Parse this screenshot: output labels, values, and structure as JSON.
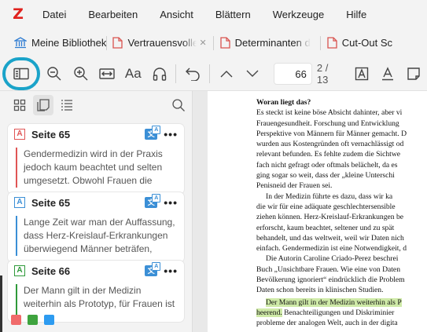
{
  "app": {
    "logo": "Z",
    "menu": [
      "Datei",
      "Bearbeiten",
      "Ansicht",
      "Blättern",
      "Werkzeuge",
      "Hilfe"
    ]
  },
  "tabs": [
    {
      "label": "Meine Bibliothek",
      "icon": "library-icon"
    },
    {
      "label": "Vertrauensvolle K",
      "icon": "pdf-icon"
    },
    {
      "label": "Determinanten d",
      "icon": "pdf-icon"
    },
    {
      "label": "Cut-Out Sc",
      "icon": "pdf-icon"
    }
  ],
  "toolbar": {
    "page_current": "66",
    "page_total": "2 / 13",
    "font_label": "Aa"
  },
  "sidebar": {
    "annotations": [
      {
        "color": "red",
        "page": "Seite 65",
        "text": "Gendermedizin wird in der Praxis jedoch kaum beachtet und selten umgesetzt. Obwohl Frauen die Hälft…"
      },
      {
        "color": "blue",
        "page": "Seite 65",
        "text": "Lange Zeit war man der Auffassung, dass Herz-Kreislauf-Erkrankungen überwiegend Männer beträfen, und…"
      },
      {
        "color": "green",
        "page": "Seite 66",
        "text": "Der Mann gilt in der Medizin weiterhin als Prototyp, für Frauen ist"
      }
    ],
    "colors": [
      "#f06a6a",
      "#3ea33e",
      "#2d9bf0"
    ]
  },
  "document": {
    "heading": "Woran liegt das?",
    "para1": [
      "Es steckt ist keine böse Absicht dahinter, aber vi",
      "Frauengesundheit. Forschung und Entwicklung",
      "Perspektive von Männern für Männer gemacht. D",
      "wurden aus Kostengründen oft vernachlässigt od",
      "relevant befunden. Es fehlte zudem die Sichtwe",
      "fach nicht gefragt oder oftmals belächelt, da es",
      "ging sogar so weit, dass der „kleine Unterschi",
      "Penisneid der Frauen sei."
    ],
    "para2": [
      "In der Medizin führte es dazu, dass wir ka",
      "die wir für eine adäquate geschlechtersensible",
      "ziehen können. Herz-Kreislauf-Erkrankungen be",
      "erforscht, kaum beachtet, seltener und zu spät",
      "behandelt, und das weltweit, weil wir Daten nich",
      "einfach. Gendermedizin ist eine Notwendigkeit, d"
    ],
    "para3": [
      "Die Autorin Caroline Criado-Perez beschrei",
      "Buch „Unsichtbare Frauen. Wie eine von Daten",
      "Bevölkerung ignoriert“ eindrücklich die Problem",
      "Daten schon bereits in klinischen Studien."
    ],
    "para4_hl1": "Der Mann gilt in der Medizin weiterhin als P",
    "para4_hl2": "heerend.",
    "para4_rest2": " Benachteiligungen und Diskriminier",
    "para4_line3": "probleme der analogen Welt, auch in der digita"
  }
}
